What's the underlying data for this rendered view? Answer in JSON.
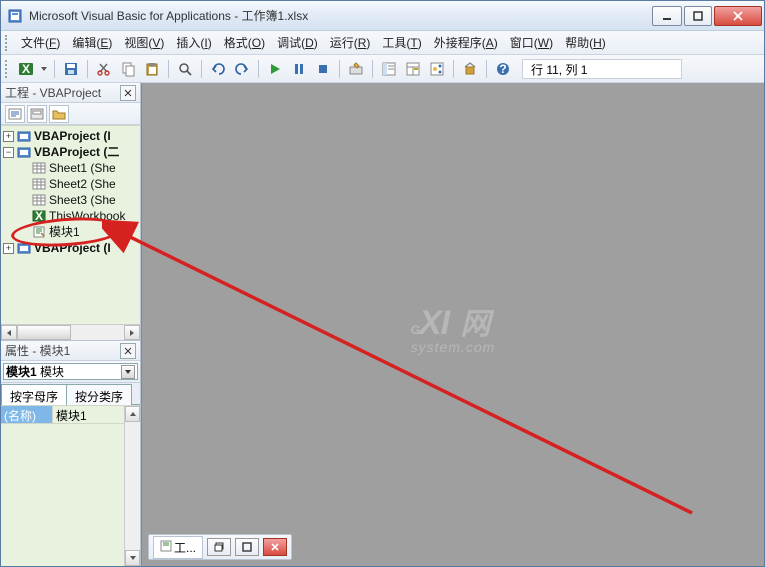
{
  "title": "Microsoft Visual Basic for Applications - 工作簿1.xlsx",
  "menu": {
    "file": "文件(F)",
    "edit": "编辑(E)",
    "view": "视图(V)",
    "insert": "插入(I)",
    "format": "格式(O)",
    "debug": "调试(D)",
    "run": "运行(R)",
    "tools": "工具(T)",
    "addins": "外接程序(A)",
    "window": "窗口(W)",
    "help": "帮助(H)"
  },
  "toolbar_status": "行 11, 列 1",
  "project": {
    "title": "工程 - VBAProject",
    "nodes": {
      "p1": "VBAProject  (I",
      "p2": "VBAProject  (二",
      "sheet1": "Sheet1 (She",
      "sheet2": "Sheet2 (She",
      "sheet3": "Sheet3 (She",
      "thiswb": "ThisWorkbook",
      "module1": "模块1",
      "p3": "VBAProject  (I"
    }
  },
  "properties": {
    "title": "属性 - 模块1",
    "selector_name": "模块1",
    "selector_type": "模块",
    "tab_alpha": "按字母序",
    "tab_cat": "按分类序",
    "rows": {
      "name_label": "(名称)",
      "name_value": "模块1"
    }
  },
  "mdi": {
    "taskbar_item": "工...",
    "watermark_main": "GXI",
    "watermark_suffix": "网",
    "watermark_sub": "system.com"
  }
}
